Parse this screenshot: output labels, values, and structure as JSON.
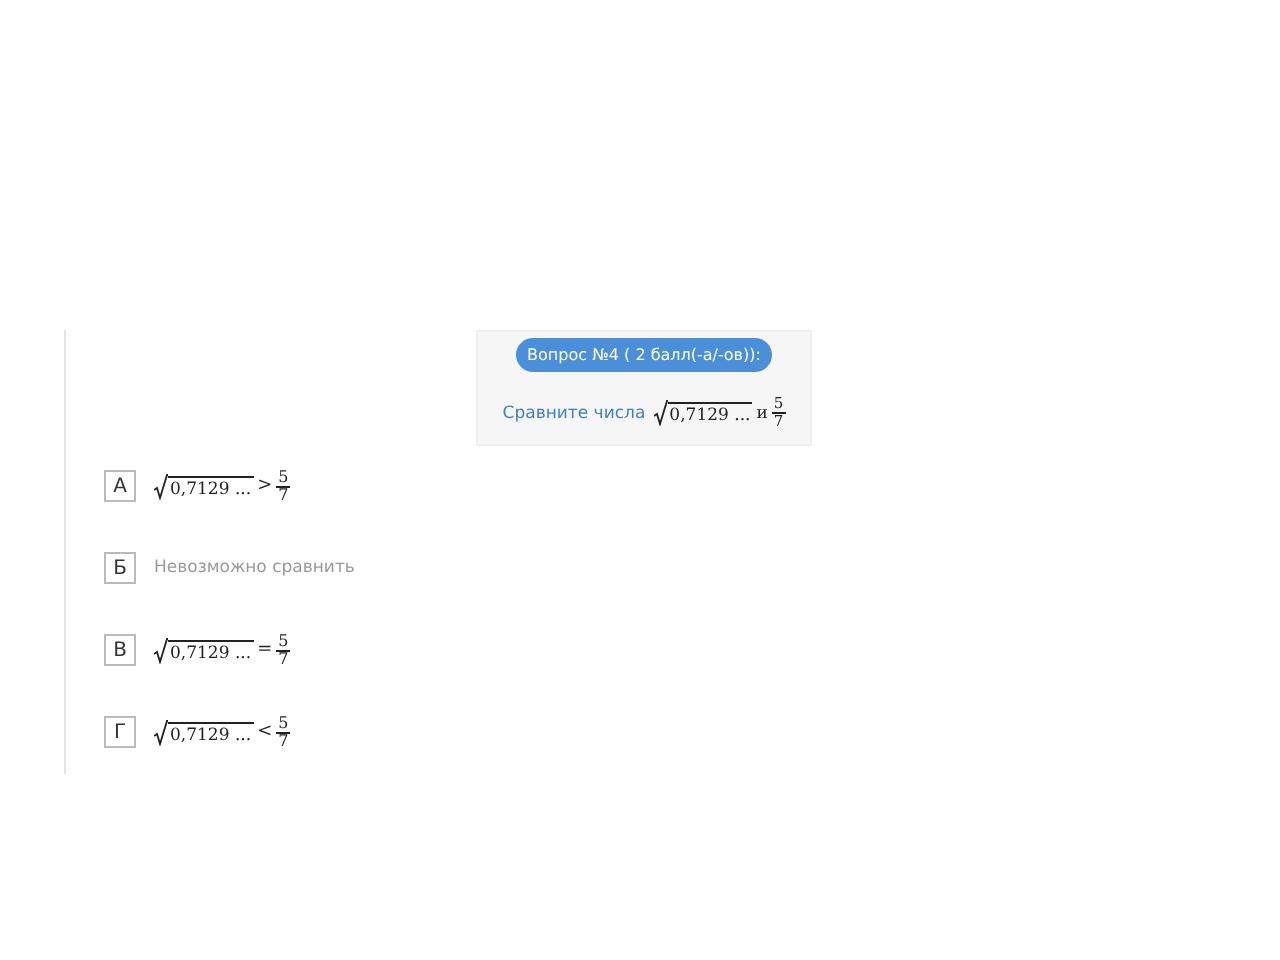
{
  "question": {
    "badge": "Вопрос №4 ( 2 балл(-а/-ов)):",
    "prompt": "Сравните числа",
    "radicand": "0,7129 ...",
    "conjunction": "и",
    "numerator": "5",
    "denominator": "7"
  },
  "answers": [
    {
      "letter": "А",
      "kind": "math",
      "radicand": "0,7129 ...",
      "operator": ">",
      "numerator": "5",
      "denominator": "7"
    },
    {
      "letter": "Б",
      "kind": "text",
      "text": "Невозможно сравнить"
    },
    {
      "letter": "В",
      "kind": "math",
      "radicand": "0,7129 ...",
      "operator": "=",
      "numerator": "5",
      "denominator": "7"
    },
    {
      "letter": "Г",
      "kind": "math",
      "radicand": "0,7129 ...",
      "operator": "<",
      "numerator": "5",
      "denominator": "7"
    }
  ]
}
